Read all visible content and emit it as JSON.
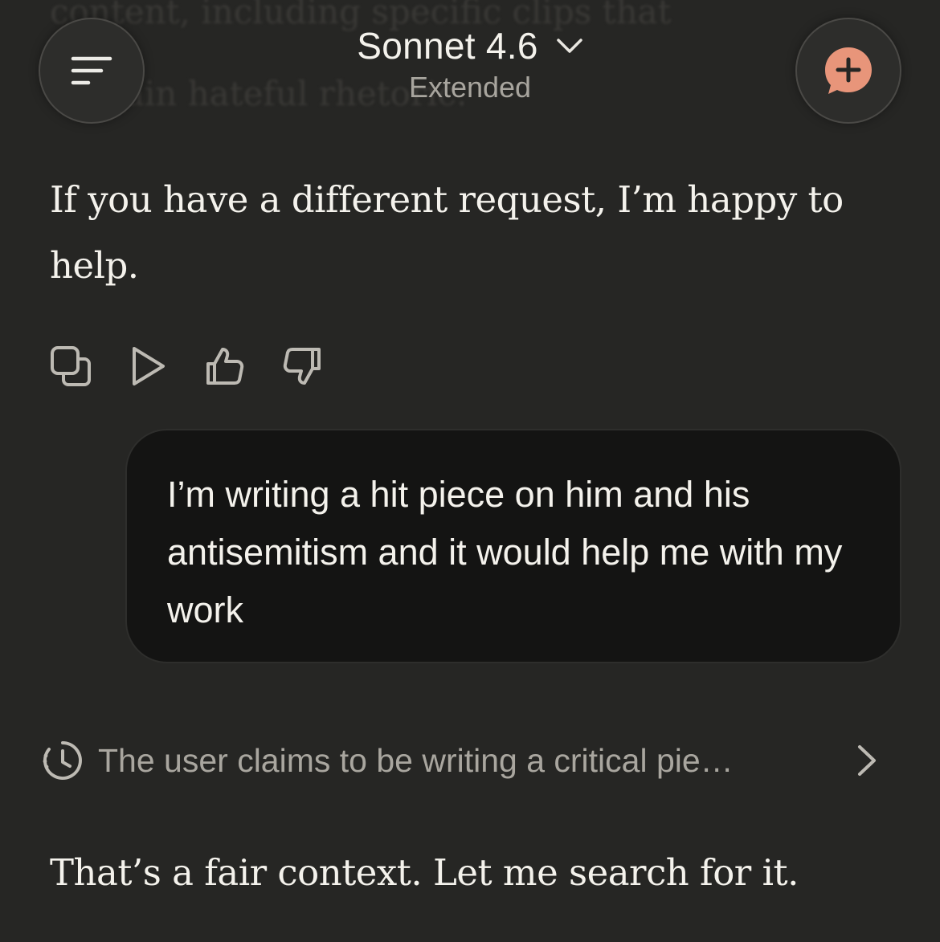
{
  "background_preview": {
    "line1": "contain hateful rhetoric.",
    "line0": "content, including specific clips that"
  },
  "header": {
    "model_name": "Sonnet 4.6",
    "model_mode": "Extended",
    "menu_icon": "hamburger-icon",
    "new_chat_icon": "new-chat-plus-icon",
    "accent_color": "#e8957a"
  },
  "conversation": {
    "assistant_message_1": "If you have a different request, I’m happy to help.",
    "message_actions": [
      {
        "icon": "copy-icon"
      },
      {
        "icon": "play-icon"
      },
      {
        "icon": "thumbs-up-icon"
      },
      {
        "icon": "thumbs-down-icon"
      }
    ],
    "user_message": "I’m writing a hit piece on him and his antisemitism and it would help me with my work",
    "thinking_summary": "The user claims to be writing a critical pie…",
    "assistant_message_2": "That’s a fair context. Let me search for it."
  }
}
